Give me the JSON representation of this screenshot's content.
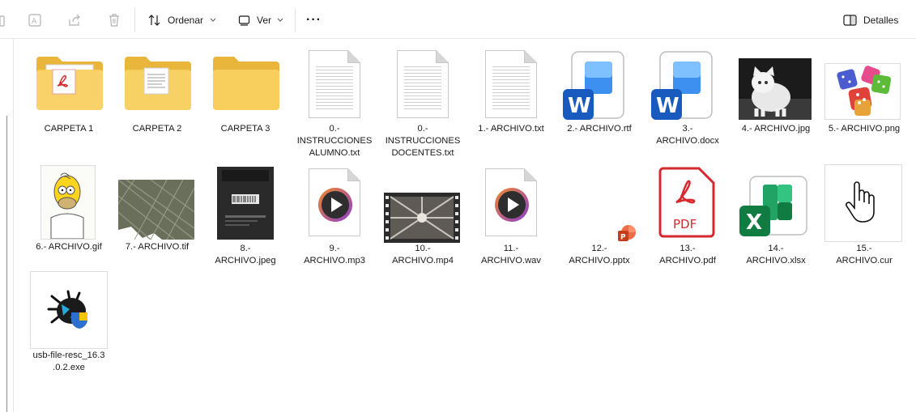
{
  "toolbar": {
    "ordenar_label": "Ordenar",
    "ver_label": "Ver",
    "more_label": "···",
    "detalles_label": "Detalles"
  },
  "files": [
    {
      "name": "CARPETA 1",
      "type": "folder-pdf"
    },
    {
      "name": "CARPETA 2",
      "type": "folder-doc"
    },
    {
      "name": "CARPETA 3",
      "type": "folder"
    },
    {
      "name": "0.-\nINSTRUCCIONES\nALUMNO.txt",
      "type": "txt"
    },
    {
      "name": "0.-\nINSTRUCCIONES\nDOCENTES.txt",
      "type": "txt"
    },
    {
      "name": "1.- ARCHIVO.txt",
      "type": "txt"
    },
    {
      "name": "2.- ARCHIVO.rtf",
      "type": "word"
    },
    {
      "name": "3.-\nARCHIVO.docx",
      "type": "word"
    },
    {
      "name": "4.- ARCHIVO.jpg",
      "type": "image-kitten"
    },
    {
      "name": "5.- ARCHIVO.png",
      "type": "image-dice"
    },
    {
      "name": "6.- ARCHIVO.gif",
      "type": "image-homer"
    },
    {
      "name": "7.- ARCHIVO.tif",
      "type": "image-map"
    },
    {
      "name": "8.-\nARCHIVO.jpeg",
      "type": "image-device"
    },
    {
      "name": "9.-\nARCHIVO.mp3",
      "type": "media"
    },
    {
      "name": "10.-\nARCHIVO.mp4",
      "type": "video"
    },
    {
      "name": "11.-\nARCHIVO.wav",
      "type": "media"
    },
    {
      "name": "12.-\nARCHIVO.pptx",
      "type": "pptx"
    },
    {
      "name": "13.-\nARCHIVO.pdf",
      "type": "pdf"
    },
    {
      "name": "14.-\nARCHIVO.xlsx",
      "type": "excel"
    },
    {
      "name": "15.-\nARCHIVO.cur",
      "type": "cursor"
    },
    {
      "name": "usb-file-resc_16.3\n.0.2.exe",
      "type": "exe"
    }
  ],
  "icons": {
    "pdf_text": "PDF",
    "word_letter": "W",
    "excel_letter": "X",
    "pptx_letter": "P"
  }
}
